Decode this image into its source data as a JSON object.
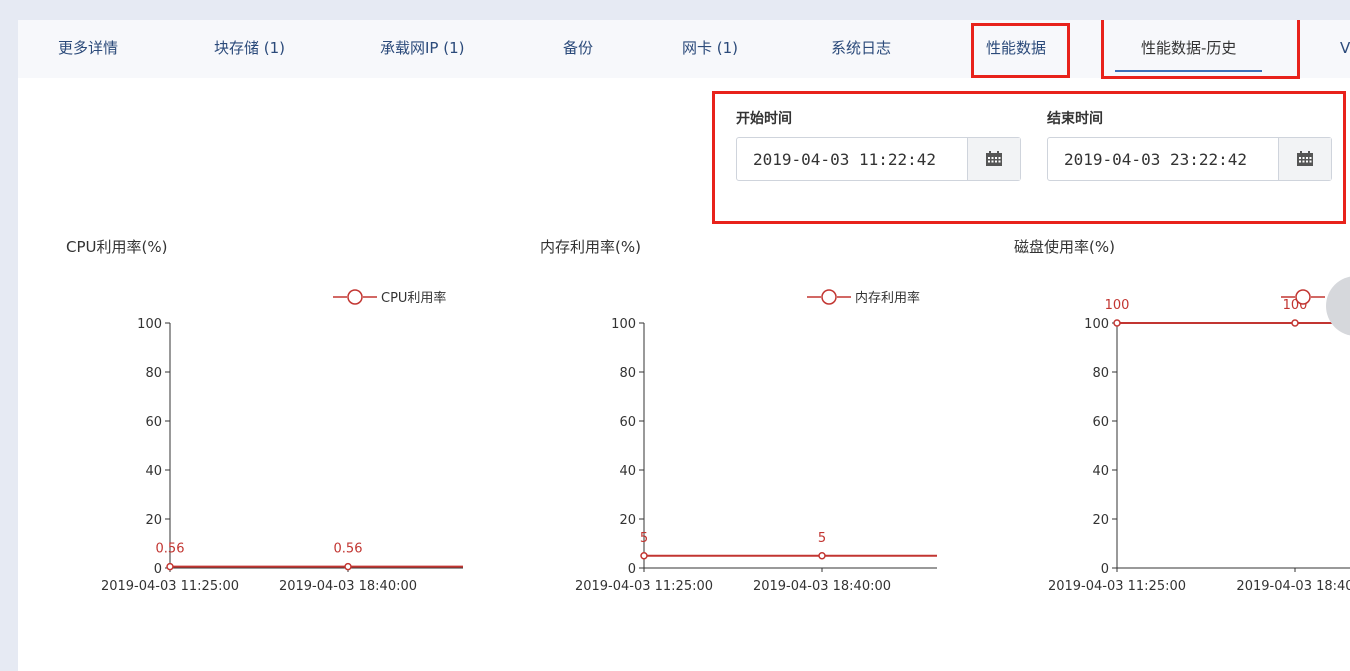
{
  "tabs": [
    {
      "label": "更多详情"
    },
    {
      "label": "块存储 (1)"
    },
    {
      "label": "承载网IP (1)"
    },
    {
      "label": "备份"
    },
    {
      "label": "网卡 (1)"
    },
    {
      "label": "系统日志"
    },
    {
      "label": "性能数据"
    },
    {
      "label": "性能数据-历史"
    },
    {
      "label": "V"
    }
  ],
  "time_range": {
    "start_label": "开始时间",
    "start_value": "2019-04-03 11:22:42",
    "end_label": "结束时间",
    "end_value": "2019-04-03 23:22:42"
  },
  "icons": {
    "calendar": "calendar-icon",
    "legend": "legend-circle-icon"
  },
  "colors": {
    "series": "#c23531",
    "highlight": "#e8221b",
    "tab_text": "#2b4a7a"
  },
  "chart_data": [
    {
      "type": "line",
      "title": "CPU利用率(%)",
      "x": [
        "2019-04-03 11:25:00",
        "2019-04-03 18:40:00"
      ],
      "series": [
        {
          "name": "CPU利用率",
          "values": [
            0.56,
            0.56
          ]
        }
      ],
      "data_labels": [
        "0.56",
        "0.56"
      ],
      "yticks": [
        "0",
        "20",
        "40",
        "60",
        "80",
        "100"
      ],
      "ylim": [
        0,
        100
      ],
      "legend": "top-right"
    },
    {
      "type": "line",
      "title": "内存利用率(%)",
      "x": [
        "2019-04-03 11:25:00",
        "2019-04-03 18:40:00"
      ],
      "series": [
        {
          "name": "内存利用率",
          "values": [
            5,
            5
          ]
        }
      ],
      "data_labels": [
        "5",
        "5"
      ],
      "yticks": [
        "0",
        "20",
        "40",
        "60",
        "80",
        "100"
      ],
      "ylim": [
        0,
        100
      ],
      "legend": "top-right"
    },
    {
      "type": "line",
      "title": "磁盘使用率(%)",
      "x": [
        "2019-04-03 11:25:00",
        "2019-04-03 18:40"
      ],
      "series": [
        {
          "name": "",
          "values": [
            100,
            100
          ]
        }
      ],
      "data_labels": [
        "100",
        "100"
      ],
      "yticks": [
        "0",
        "20",
        "40",
        "60",
        "80",
        "100"
      ],
      "ylim": [
        0,
        100
      ],
      "legend": "top-right"
    }
  ]
}
